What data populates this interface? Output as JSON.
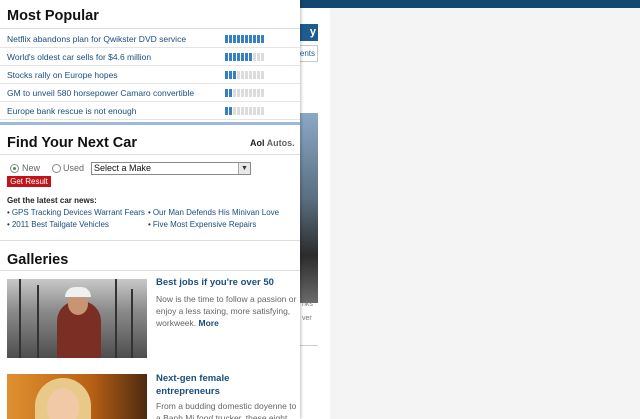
{
  "background": {
    "button_fragment": "y",
    "link_fragment": "ents",
    "caption_fragment_1": "nks",
    "caption_fragment_2": "ver"
  },
  "most_popular": {
    "title": "Most Popular",
    "items": [
      {
        "label": "Netflix abandons plan for Qwikster DVD service",
        "popularity": 10
      },
      {
        "label": "World's oldest car sells for $4.6 million",
        "popularity": 7
      },
      {
        "label": "Stocks rally on Europe hopes",
        "popularity": 3
      },
      {
        "label": "GM to unveil 580 horsepower Camaro convertible",
        "popularity": 2
      },
      {
        "label": "Europe bank rescue is not enough",
        "popularity": 2
      }
    ],
    "meter_total": 10,
    "meter_color": "#3480c0"
  },
  "car_finder": {
    "title": "Find Your Next Car",
    "brand_prefix": "Aol",
    "brand_suffix": "Autos.",
    "radio_new": "New",
    "radio_used": "Used",
    "make_select": "Select a Make",
    "submit": "Get Result",
    "news_heading": "Get the latest car news:",
    "news": [
      "GPS Tracking Devices Warrant Fears",
      "Our Man Defends His Minivan Love",
      "2011 Best Tailgate Vehicles",
      "Five Most Expensive Repairs"
    ]
  },
  "galleries": {
    "title": "Galleries",
    "items": [
      {
        "title": "Best jobs if you're over 50",
        "description": "Now is the time to follow a passion or enjoy a less taxing, more satisfying, workweek.",
        "more": "More"
      },
      {
        "title": "Next-gen female entrepreneurs",
        "description": "From a budding domestic doyenne to a Banh Mi food trucker, these eight"
      }
    ]
  }
}
